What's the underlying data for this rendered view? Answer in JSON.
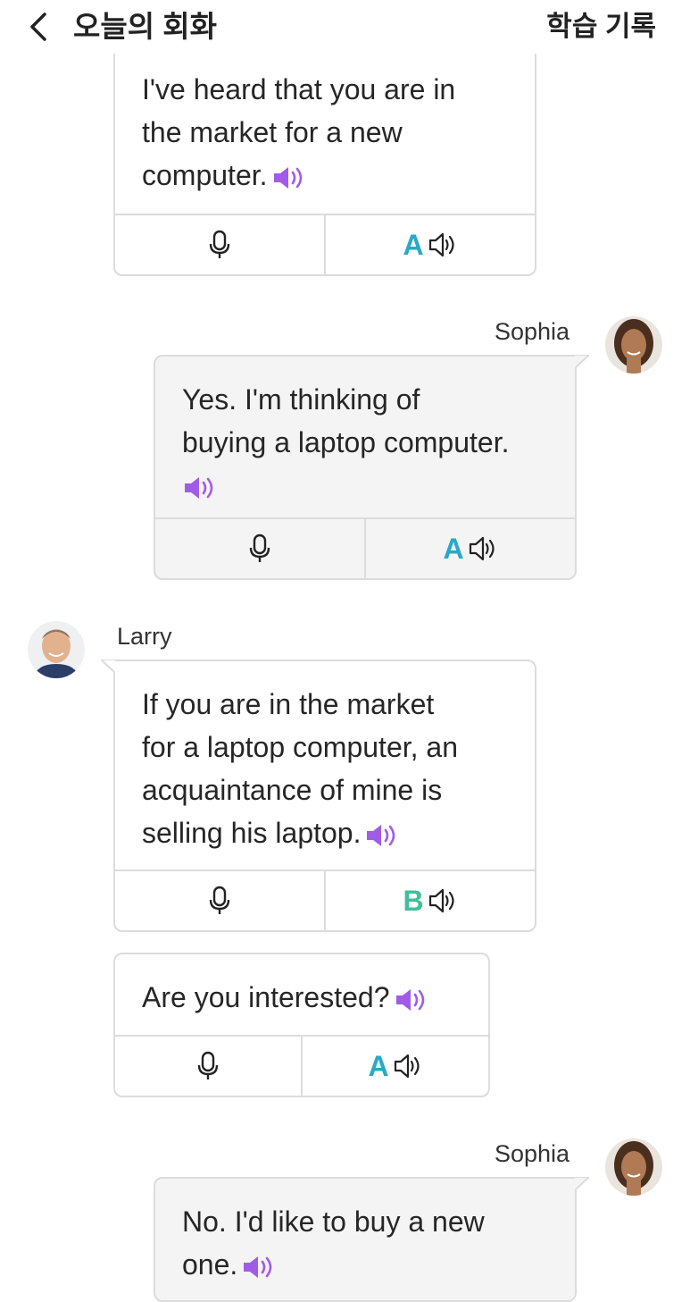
{
  "header": {
    "back_icon": "chevron-left-icon",
    "title": "오늘의 회화",
    "history_label": "학습 기록"
  },
  "colors": {
    "speaker_icon": "#a05ce6",
    "grade_A": "#2aa8c7",
    "grade_B": "#3fbf9a",
    "bubble_gray": "#f4f4f4",
    "border": "#dcdcdc"
  },
  "messages": [
    {
      "speaker": "Larry",
      "text": "I've heard that you are in the market for a new computer.",
      "grade": "A"
    },
    {
      "speaker": "Sophia",
      "text": "Yes. I'm thinking of buying a laptop computer.",
      "grade": "A"
    },
    {
      "speaker": "Larry",
      "text": "If you are in the market for a laptop computer, an acquaintance of mine is selling his laptop.",
      "grade": "B"
    },
    {
      "speaker": "Larry",
      "text": "Are you interested?",
      "grade": "A"
    },
    {
      "speaker": "Sophia",
      "text": "No. I'd like to buy a new one."
    }
  ],
  "lines": {
    "m0": [
      "I've heard that you are in",
      "the market for a new",
      "computer."
    ],
    "m1": [
      "Yes. I'm thinking of",
      "buying a laptop computer."
    ],
    "m2": [
      "If you are in the market",
      "for a laptop computer, an",
      "acquaintance of mine is",
      "selling his laptop."
    ],
    "m3": [
      "Are you interested?"
    ],
    "m4": [
      "No. I'd like to buy a new",
      "one."
    ]
  }
}
